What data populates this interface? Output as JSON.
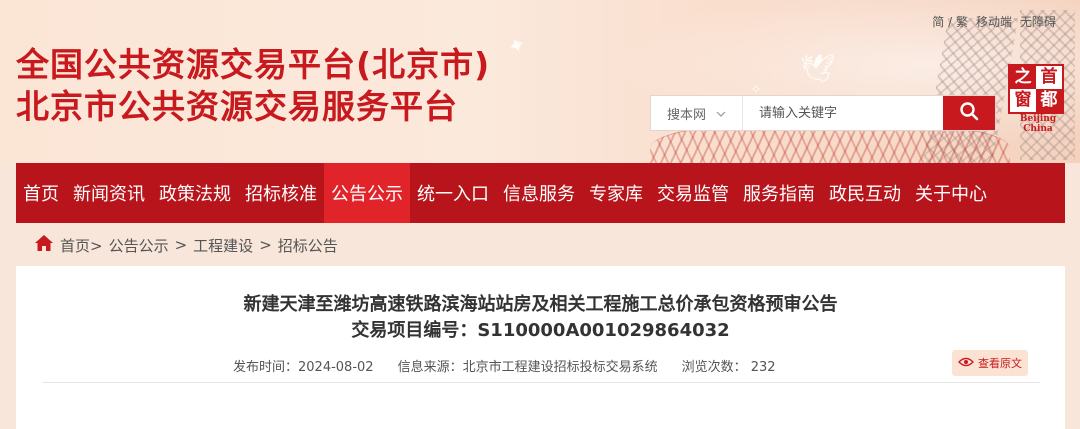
{
  "header": {
    "title_line1": "全国公共资源交易平台(北京市)",
    "title_line2": "北京市公共资源交易服务平台",
    "top_links": [
      "简 / 繁",
      "移动端",
      "无障碍"
    ],
    "search": {
      "scope": "搜本网",
      "placeholder": "请输入关键字"
    },
    "logo": {
      "chars": [
        "之",
        "首",
        "窗",
        "都"
      ],
      "caption": "Beijing China"
    }
  },
  "nav": {
    "items": [
      "首页",
      "新闻资讯",
      "政策法规",
      "招标核准",
      "公告公示",
      "统一入口",
      "信息服务",
      "专家库",
      "交易监管",
      "服务指南",
      "政民互动",
      "关于中心"
    ],
    "active": "公告公示"
  },
  "breadcrumb": {
    "home": "首页>",
    "items": [
      "公告公示",
      "工程建设",
      "招标公告"
    ],
    "separator": ">"
  },
  "article": {
    "title": "新建天津至潍坊高速铁路滨海站站房及相关工程施工总价承包资格预审公告",
    "project_no": "交易项目编号：S110000A001029864032",
    "publish_time": "发布时间：2024-08-02",
    "source": "信息来源：北京市工程建设招标投标交易系统",
    "views": "浏览次数： 232",
    "view_original": "查看原文"
  },
  "colors": {
    "brand_red": "#c8191e",
    "nav_red": "#b7151b",
    "nav_active": "#e0242a"
  }
}
